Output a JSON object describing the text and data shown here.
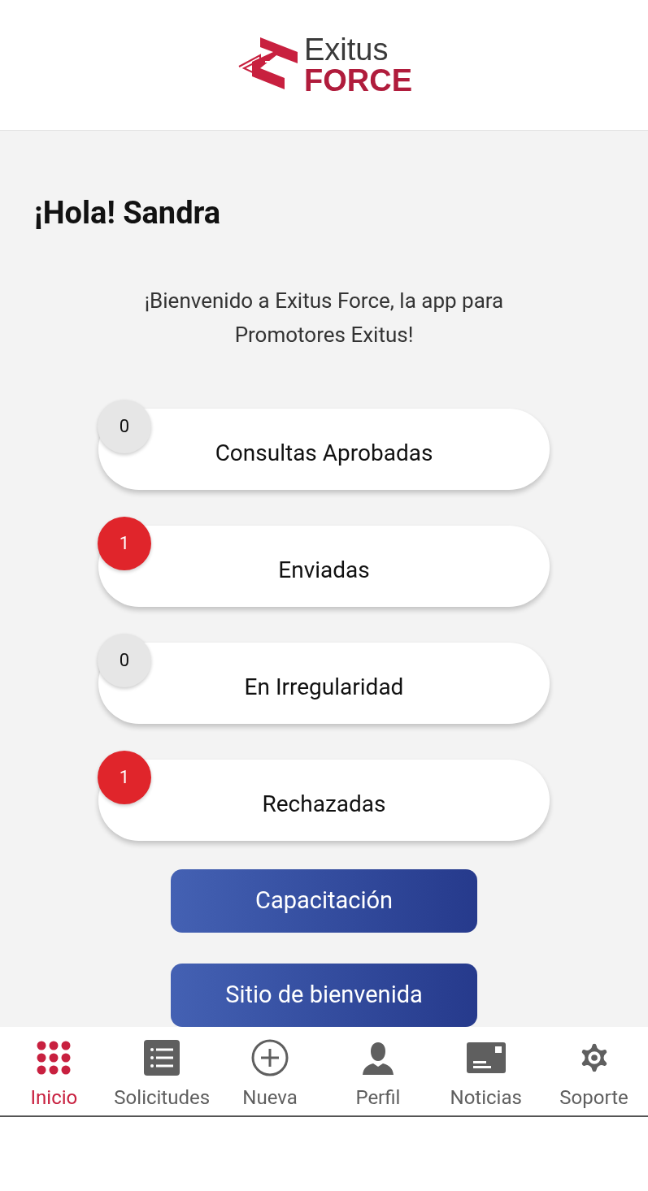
{
  "logo": {
    "line1": "Exitus",
    "line2": "FORCE"
  },
  "greeting": "¡Hola! Sandra",
  "welcome": "¡Bienvenido a Exitus Force, la app para Promotores Exitus!",
  "status_cards": [
    {
      "count": "0",
      "label": "Consultas Aprobadas",
      "color": "#e6e6e6"
    },
    {
      "count": "1",
      "label": "Enviadas",
      "color": "#e0252b"
    },
    {
      "count": "0",
      "label": "En Irregularidad",
      "color": "#e6e6e6"
    },
    {
      "count": "1",
      "label": "Rechazadas",
      "color": "#e0252b"
    }
  ],
  "buttons": [
    "Capacitación",
    "Sitio de bienvenida"
  ],
  "bottom_nav": [
    {
      "kind": "grid",
      "label": "Inicio",
      "selected": true
    },
    {
      "kind": "list",
      "label": "Solicitudes",
      "selected": false
    },
    {
      "kind": "plus",
      "label": "Nueva",
      "selected": false
    },
    {
      "kind": "person",
      "label": "Perfil",
      "selected": false
    },
    {
      "kind": "mail",
      "label": "Noticias",
      "selected": false
    },
    {
      "kind": "gear",
      "label": "Soporte",
      "selected": false
    }
  ]
}
